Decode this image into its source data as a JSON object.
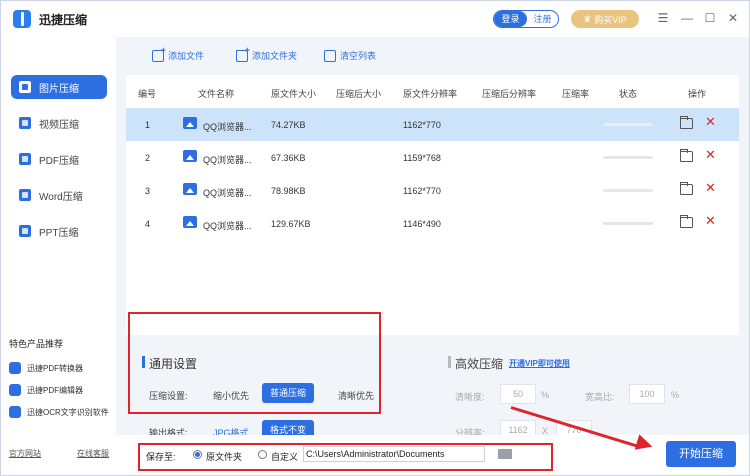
{
  "app": {
    "title": "迅捷压缩"
  },
  "header": {
    "login": "登录",
    "register": "注册",
    "vip": "购买VIP"
  },
  "window_controls": {
    "menu": "☰",
    "minimize": "—",
    "maximize": "☐",
    "close": "✕"
  },
  "sidebar": {
    "items": [
      {
        "label": "图片压缩",
        "active": true
      },
      {
        "label": "视频压缩",
        "active": false
      },
      {
        "label": "PDF压缩",
        "active": false
      },
      {
        "label": "Word压缩",
        "active": false
      },
      {
        "label": "PPT压缩",
        "active": false
      }
    ],
    "featured_title": "特色产品推荐",
    "featured": [
      {
        "label": "迅捷PDF转换器"
      },
      {
        "label": "迅捷PDF编辑器"
      },
      {
        "label": "迅捷OCR文字识别软件"
      }
    ],
    "footer": {
      "official_site": "官方网站",
      "online_support": "在线客服"
    }
  },
  "toolbar": {
    "add_file": "添加文件",
    "add_folder": "添加文件夹",
    "clear_list": "清空列表"
  },
  "table": {
    "headers": [
      "编号",
      "文件名称",
      "原文件大小",
      "压缩后大小",
      "原文件分辨率",
      "压缩后分辨率",
      "压缩率",
      "状态",
      "操作"
    ],
    "rows": [
      {
        "num": "1",
        "name": "QQ浏览器...",
        "size": "74.27KB",
        "resolution": "1162*770",
        "selected": true
      },
      {
        "num": "2",
        "name": "QQ浏览器...",
        "size": "67.36KB",
        "resolution": "1159*768",
        "selected": false
      },
      {
        "num": "3",
        "name": "QQ浏览器...",
        "size": "78.98KB",
        "resolution": "1162*770",
        "selected": false
      },
      {
        "num": "4",
        "name": "QQ浏览器...",
        "size": "129.67KB",
        "resolution": "1146*490",
        "selected": false
      }
    ]
  },
  "general": {
    "title": "通用设置",
    "compress_label": "压缩设置:",
    "compress_options": [
      "缩小优先",
      "普通压缩",
      "清晰优先"
    ],
    "output_label": "输出格式:",
    "output_options": [
      "JPG格式",
      "格式不变"
    ]
  },
  "efficient": {
    "title": "高效压缩",
    "vip_link": "开通VIP即可使用",
    "clarity_label": "清晰度:",
    "clarity_value": "50",
    "clarity_unit": "%",
    "ratio_label": "宽高比:",
    "ratio_value": "100",
    "ratio_unit": "%",
    "resolution_label": "分辨率:",
    "res_w": "1162",
    "res_x": "X",
    "res_h": "770"
  },
  "save": {
    "label": "保存至:",
    "option_original": "原文件夹",
    "option_custom": "自定义",
    "path": "C:\\Users\\Administrator\\Documents"
  },
  "start_button": "开始压缩",
  "colors": {
    "accent": "#2d6fe0",
    "highlight": "#e0242e",
    "vip": "#e9c481",
    "selected_row": "#cde3fa"
  }
}
